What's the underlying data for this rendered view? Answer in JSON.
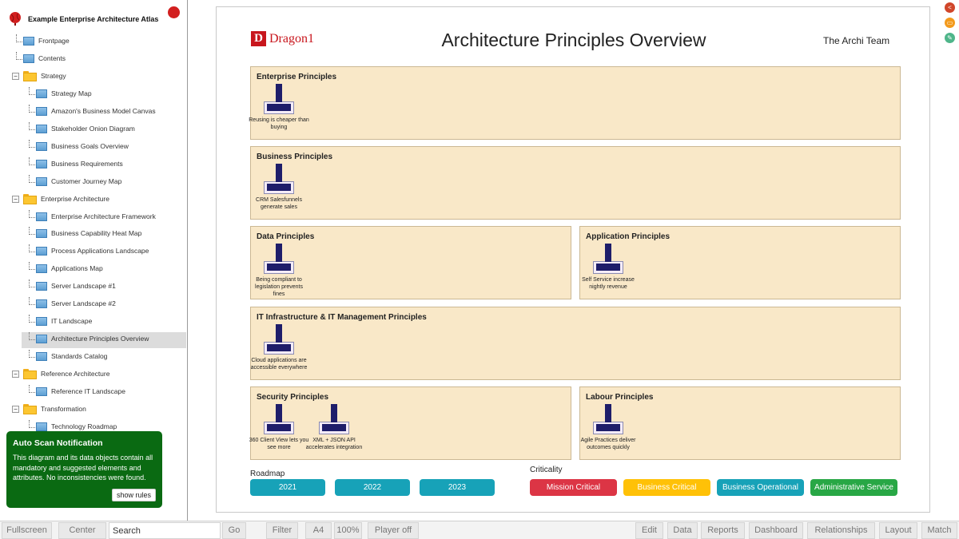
{
  "atlas": {
    "title": "Example Enterprise Architecture Atlas"
  },
  "tree": [
    {
      "label": "Frontpage",
      "type": "view"
    },
    {
      "label": "Contents",
      "type": "view"
    },
    {
      "label": "Strategy",
      "type": "folder"
    },
    {
      "label": "Strategy Map",
      "type": "view"
    },
    {
      "label": "Amazon's Business Model Canvas",
      "type": "view"
    },
    {
      "label": "Stakeholder Onion Diagram",
      "type": "view"
    },
    {
      "label": "Business Goals Overview",
      "type": "view"
    },
    {
      "label": "Business Requirements",
      "type": "view"
    },
    {
      "label": "Customer Journey Map",
      "type": "view"
    },
    {
      "label": "Enterprise Architecture",
      "type": "folder"
    },
    {
      "label": "Enterprise Architecture Framework",
      "type": "view"
    },
    {
      "label": "Business Capability Heat Map",
      "type": "view"
    },
    {
      "label": "Process Applications Landscape",
      "type": "view"
    },
    {
      "label": "Applications Map",
      "type": "view"
    },
    {
      "label": "Server Landscape #1",
      "type": "view"
    },
    {
      "label": "Server Landscape #2",
      "type": "view"
    },
    {
      "label": "IT Landscape",
      "type": "view"
    },
    {
      "label": "Architecture Principles Overview",
      "type": "view",
      "selected": true
    },
    {
      "label": "Standards Catalog",
      "type": "view"
    },
    {
      "label": "Reference Architecture",
      "type": "folder"
    },
    {
      "label": "Reference IT Landscape",
      "type": "view"
    },
    {
      "label": "Transformation",
      "type": "folder"
    },
    {
      "label": "Technology Roadmap",
      "type": "view"
    }
  ],
  "notification": {
    "title": "Auto Scan Notification",
    "text": "This diagram and its data objects contain all mandatory and suggested elements and attributes. No inconsistencies were found.",
    "button": "show rules"
  },
  "diagram": {
    "logo_letter": "D",
    "logo_text": "Dragon1",
    "title": "Architecture Principles Overview",
    "team": "The Archi Team",
    "groups": [
      {
        "title": "Enterprise Principles",
        "principles": [
          "Reusing is cheaper than buying"
        ]
      },
      {
        "title": "Business Principles",
        "principles": [
          "CRM Salesfunnels generate sales"
        ]
      },
      {
        "title": "Data Principles",
        "principles": [
          "Being compliant to legislation prevents fines"
        ]
      },
      {
        "title": "Application Principles",
        "principles": [
          "Self Service increase nightly revenue"
        ]
      },
      {
        "title": "IT Infrastructure & IT Management Principles",
        "principles": [
          "Cloud applications are accessible everywhere"
        ]
      },
      {
        "title": "Security Principles",
        "principles": [
          "360 Client View lets you see more",
          "XML + JSON API accelerates integration"
        ]
      },
      {
        "title": "Labour Principles",
        "principles": [
          "Agile Practices deliver outcomes quickly"
        ]
      }
    ],
    "roadmap": {
      "heading": "Roadmap",
      "items": [
        "2021",
        "2022",
        "2023"
      ],
      "color": "#17a2b8"
    },
    "criticality": {
      "heading": "Criticality",
      "items": [
        {
          "label": "Mission Critical",
          "color": "#dc3545"
        },
        {
          "label": "Business Critical",
          "color": "#ffc107"
        },
        {
          "label": "Business Operational",
          "color": "#17a2b8"
        },
        {
          "label": "Administrative Service",
          "color": "#28a745"
        }
      ]
    }
  },
  "side_icons": [
    {
      "name": "share-icon",
      "glyph": "<",
      "color": "#d0462a"
    },
    {
      "name": "comment-icon",
      "glyph": "▭",
      "color": "#f39a1c"
    },
    {
      "name": "edit-icon",
      "glyph": "✎",
      "color": "#4fb58a"
    }
  ],
  "toolbar": {
    "fullscreen": "Fullscreen",
    "center": "Center",
    "search_placeholder": "Search",
    "go": "Go",
    "filter": "Filter",
    "paper": "A4",
    "zoom": "100%",
    "player": "Player off",
    "edit": "Edit",
    "data": "Data",
    "reports": "Reports",
    "dashboard": "Dashboard",
    "relationships": "Relationships",
    "layout": "Layout",
    "match": "Match"
  }
}
